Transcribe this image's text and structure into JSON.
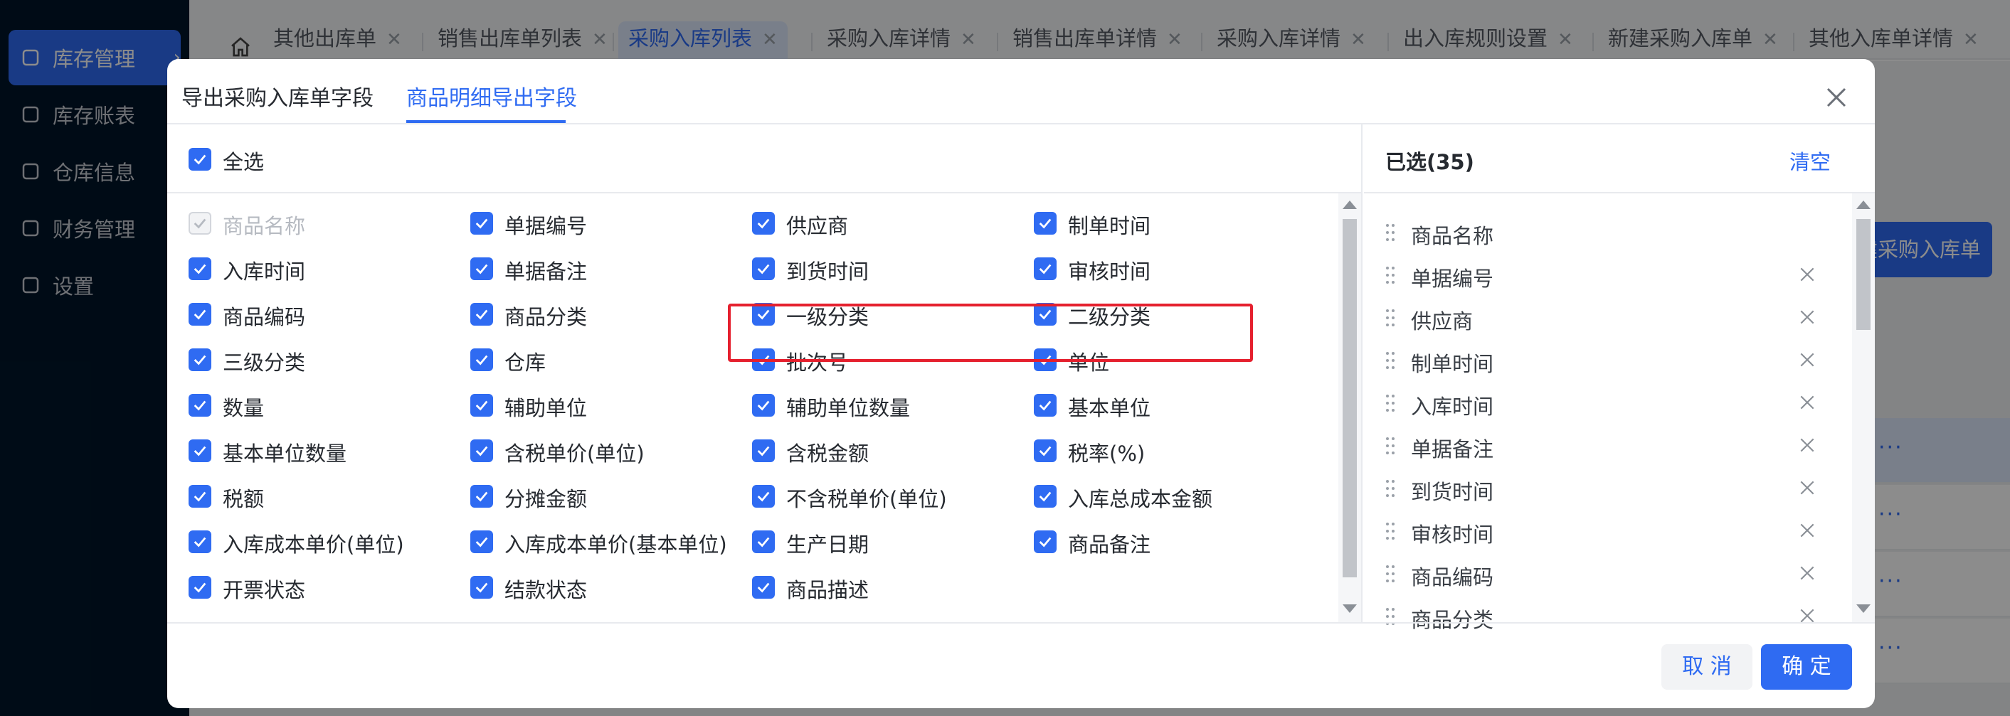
{
  "sidebar": {
    "items": [
      {
        "label": "库存管理",
        "icon": "warehouse-icon"
      },
      {
        "label": "库存账表",
        "icon": "pie-chart-icon"
      },
      {
        "label": "仓库信息",
        "icon": "gear-box-icon"
      },
      {
        "label": "财务管理",
        "icon": "yen-icon"
      },
      {
        "label": "设置",
        "icon": "settings-icon"
      }
    ]
  },
  "tabs": [
    {
      "label": "其他出库单"
    },
    {
      "label": "销售出库单列表"
    },
    {
      "label": "采购入库列表"
    },
    {
      "label": "采购入库详情"
    },
    {
      "label": "销售出库单详情"
    },
    {
      "label": "采购入库详情"
    },
    {
      "label": "出入库规则设置"
    },
    {
      "label": "新建采购入库单"
    },
    {
      "label": "其他入库单详情"
    }
  ],
  "background": {
    "new_button": "建采购入库单",
    "row_action": "···"
  },
  "modal": {
    "tabs": [
      {
        "label": "导出采购入库单字段"
      },
      {
        "label": "商品明细导出字段"
      }
    ],
    "select_all": "全选",
    "fields": [
      {
        "label": "商品名称",
        "checked": true,
        "disabled": true
      },
      {
        "label": "单据编号",
        "checked": true
      },
      {
        "label": "供应商",
        "checked": true
      },
      {
        "label": "制单时间",
        "checked": true
      },
      {
        "label": "入库时间",
        "checked": true
      },
      {
        "label": "单据备注",
        "checked": true
      },
      {
        "label": "到货时间",
        "checked": true
      },
      {
        "label": "审核时间",
        "checked": true
      },
      {
        "label": "商品编码",
        "checked": true
      },
      {
        "label": "商品分类",
        "checked": true
      },
      {
        "label": "一级分类",
        "checked": true
      },
      {
        "label": "二级分类",
        "checked": true
      },
      {
        "label": "三级分类",
        "checked": true
      },
      {
        "label": "仓库",
        "checked": true
      },
      {
        "label": "批次号",
        "checked": true
      },
      {
        "label": "单位",
        "checked": true
      },
      {
        "label": "数量",
        "checked": true
      },
      {
        "label": "辅助单位",
        "checked": true
      },
      {
        "label": "辅助单位数量",
        "checked": true
      },
      {
        "label": "基本单位",
        "checked": true
      },
      {
        "label": "基本单位数量",
        "checked": true
      },
      {
        "label": "含税单价(单位)",
        "checked": true
      },
      {
        "label": "含税金额",
        "checked": true
      },
      {
        "label": "税率(%)",
        "checked": true
      },
      {
        "label": "税额",
        "checked": true
      },
      {
        "label": "分摊金额",
        "checked": true
      },
      {
        "label": "不含税单价(单位)",
        "checked": true
      },
      {
        "label": "入库总成本金额",
        "checked": true
      },
      {
        "label": "入库成本单价(单位)",
        "checked": true
      },
      {
        "label": "入库成本单价(基本单位)",
        "checked": true
      },
      {
        "label": "生产日期",
        "checked": true
      },
      {
        "label": "商品备注",
        "checked": true
      },
      {
        "label": "开票状态",
        "checked": true
      },
      {
        "label": "结款状态",
        "checked": true
      },
      {
        "label": "商品描述",
        "checked": true
      }
    ],
    "selected_title": "已选(35)",
    "clear_label": "清空",
    "selected_items": [
      {
        "label": "商品名称",
        "removable": false
      },
      {
        "label": "单据编号",
        "removable": true
      },
      {
        "label": "供应商",
        "removable": true
      },
      {
        "label": "制单时间",
        "removable": true
      },
      {
        "label": "入库时间",
        "removable": true
      },
      {
        "label": "单据备注",
        "removable": true
      },
      {
        "label": "到货时间",
        "removable": true
      },
      {
        "label": "审核时间",
        "removable": true
      },
      {
        "label": "商品编码",
        "removable": true
      },
      {
        "label": "商品分类",
        "removable": true
      }
    ],
    "cancel_label": "取 消",
    "ok_label": "确 定"
  },
  "colors": {
    "primary": "#2f6bf2",
    "highlight": "#e5202e",
    "sidebar_bg": "#001529"
  }
}
